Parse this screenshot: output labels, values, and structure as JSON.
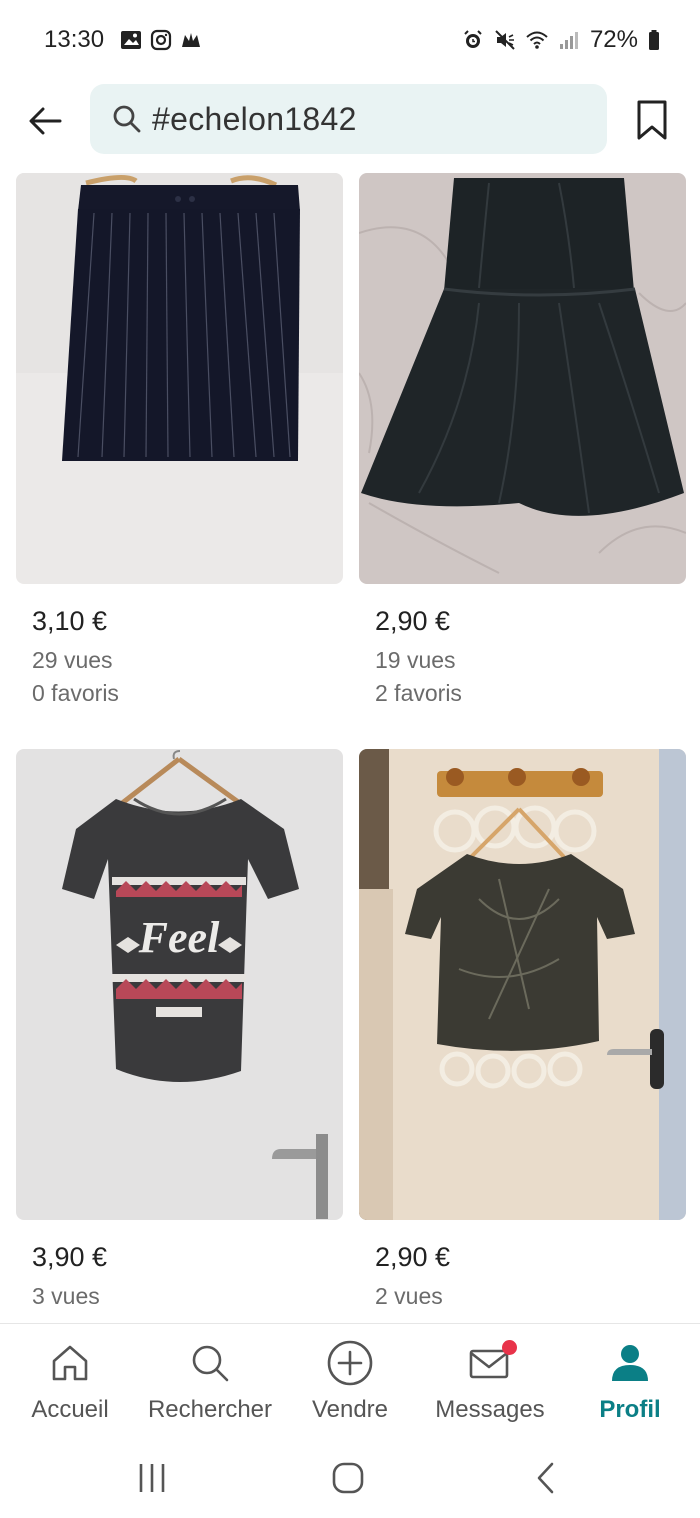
{
  "status_bar": {
    "time": "13:30",
    "battery": "72%",
    "left_icons": [
      "gallery-icon",
      "instagram-icon",
      "app-icon"
    ],
    "right_icons": [
      "alarm-icon",
      "mute-icon",
      "wifi-icon",
      "signal-icon",
      "battery-icon"
    ]
  },
  "header": {
    "search_value": "#echelon1842",
    "back_icon": "arrow-left-icon",
    "bookmark_icon": "bookmark-icon"
  },
  "items": [
    {
      "price": "3,10 €",
      "views": "29 vues",
      "favorites": "0 favoris",
      "image": "black-skirt"
    },
    {
      "price": "2,90 €",
      "views": "19 vues",
      "favorites": "2 favoris",
      "image": "black-dress"
    },
    {
      "price": "3,90 €",
      "views": "3 vues",
      "favorites": "",
      "image": "grey-tshirt-feel"
    },
    {
      "price": "2,90 €",
      "views": "2 vues",
      "favorites": "",
      "image": "dark-top"
    }
  ],
  "tshirt_print": "Feel",
  "nav": {
    "items": [
      {
        "label": "Accueil",
        "icon": "home-icon"
      },
      {
        "label": "Rechercher",
        "icon": "search-icon"
      },
      {
        "label": "Vendre",
        "icon": "plus-circle-icon"
      },
      {
        "label": "Messages",
        "icon": "mail-icon"
      },
      {
        "label": "Profil",
        "icon": "profile-icon"
      }
    ],
    "active": "Profil",
    "notification_dot": "Messages"
  },
  "colors": {
    "accent": "#0b7f86",
    "search_bg": "#e9f3f3",
    "badge": "#e8334a"
  }
}
